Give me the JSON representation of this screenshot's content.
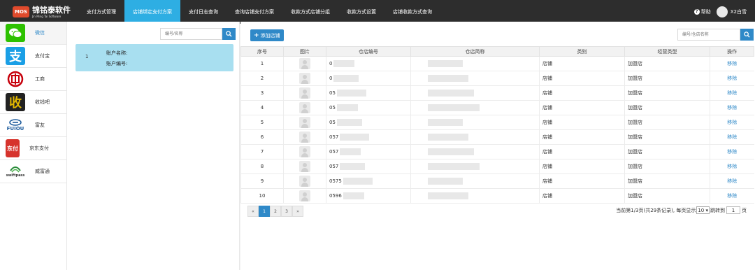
{
  "brand": {
    "badge": "MOS",
    "name_cn": "锦铭泰软件",
    "name_en": "Jin Ming Tai Software"
  },
  "nav": [
    {
      "label": "支付方式管理",
      "active": false
    },
    {
      "label": "店铺绑定支付方案",
      "active": true
    },
    {
      "label": "支付日志查询",
      "active": false
    },
    {
      "label": "查询店铺支付方案",
      "active": false
    },
    {
      "label": "收款方式店铺分组",
      "active": false
    },
    {
      "label": "收款方式设置",
      "active": false
    },
    {
      "label": "店铺收款方式查询",
      "active": false
    }
  ],
  "user": {
    "help": "帮助",
    "name": "X2白雪"
  },
  "sidebar": [
    {
      "label": "微信",
      "icon": "wechat-icon",
      "color": "#2dc100",
      "active": true
    },
    {
      "label": "支付宝",
      "icon": "alipay-icon",
      "color": "#1a9fe6"
    },
    {
      "label": "工商",
      "icon": "icbc-icon",
      "color": "#c7000b"
    },
    {
      "label": "收钱吧",
      "icon": "shouqianba-icon",
      "color": "#e3b800"
    },
    {
      "label": "富友",
      "icon": "fuiou-icon",
      "color": "#1b5a9c"
    },
    {
      "label": "京东支付",
      "icon": "jdpay-icon",
      "color": "#d6332c"
    },
    {
      "label": "威富通",
      "icon": "swiftpass-icon",
      "color": "#2a8c3a"
    }
  ],
  "mid": {
    "search_placeholder": "编号/名称",
    "account": {
      "index": "1",
      "name_label": "账户名称:",
      "number_label": "账户编号:"
    }
  },
  "main": {
    "add_label": "添加店铺",
    "search_placeholder": "编号/仓店名称",
    "columns": [
      "序号",
      "图片",
      "仓店编号",
      "仓店简称",
      "类别",
      "经营类型",
      "操作"
    ],
    "rows": [
      {
        "idx": "1",
        "code": "0",
        "category": "店铺",
        "biz": "加盟店",
        "action": "移除"
      },
      {
        "idx": "2",
        "code": "0",
        "category": "店铺",
        "biz": "加盟店",
        "action": "移除"
      },
      {
        "idx": "3",
        "code": "05",
        "category": "店铺",
        "biz": "加盟店",
        "action": "移除"
      },
      {
        "idx": "4",
        "code": "05",
        "category": "店铺",
        "biz": "加盟店",
        "action": "移除"
      },
      {
        "idx": "5",
        "code": "05",
        "category": "店铺",
        "biz": "加盟店",
        "action": "移除"
      },
      {
        "idx": "6",
        "code": "057",
        "category": "店铺",
        "biz": "加盟店",
        "action": "移除"
      },
      {
        "idx": "7",
        "code": "057",
        "category": "店铺",
        "biz": "加盟店",
        "action": "移除"
      },
      {
        "idx": "8",
        "code": "057",
        "category": "店铺",
        "biz": "加盟店",
        "action": "移除"
      },
      {
        "idx": "9",
        "code": "0575",
        "category": "店铺",
        "biz": "加盟店",
        "action": "移除"
      },
      {
        "idx": "10",
        "code": "0596",
        "category": "店铺",
        "biz": "加盟店",
        "action": "移除"
      }
    ],
    "pager": {
      "prev": "«",
      "pages": [
        "1",
        "2",
        "3"
      ],
      "current": "1",
      "next": "»",
      "info": "当前第1/3页(共29条记录), 每页显示",
      "page_size": "10",
      "jump_label": "跳转到",
      "jump_value": "1",
      "jump_unit": "页"
    }
  },
  "colors": {
    "accent": "#2f89c8",
    "nav_active": "#2eaee3",
    "topbar": "#2d2d2d",
    "card": "#a8dff0"
  }
}
